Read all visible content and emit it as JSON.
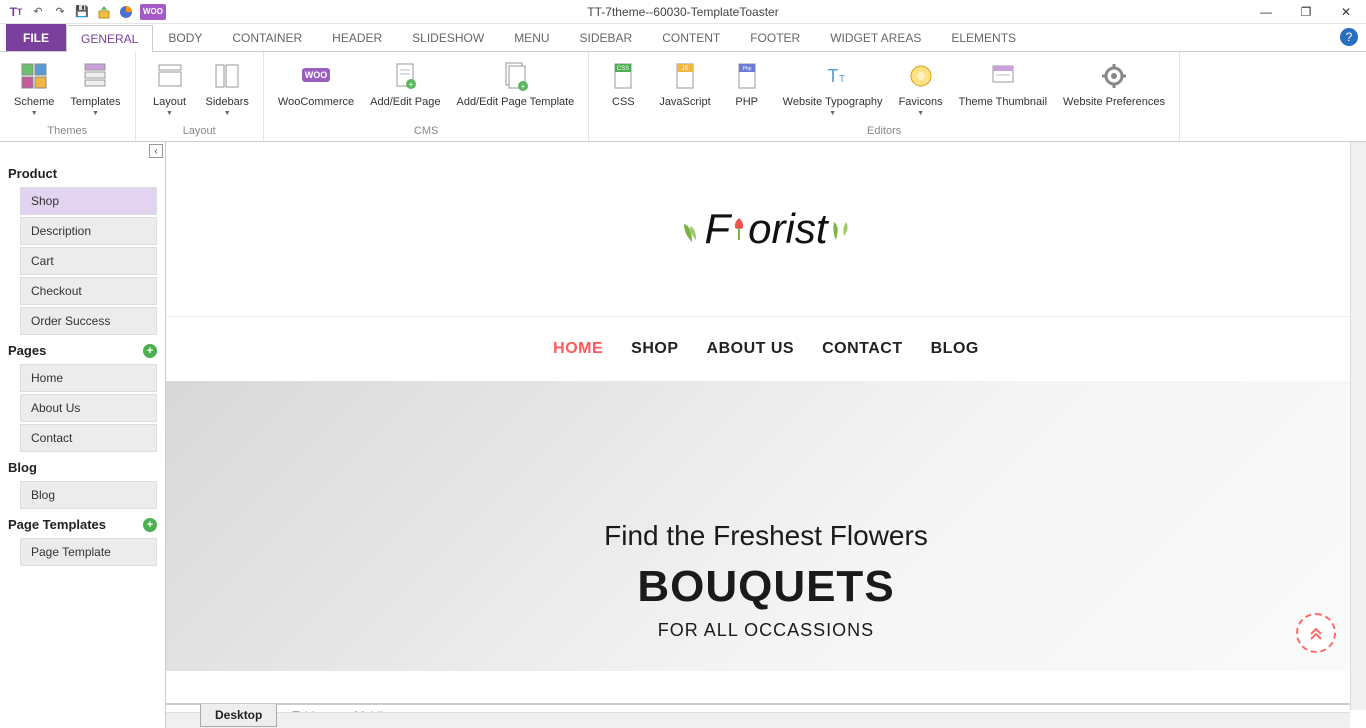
{
  "window": {
    "title": "TT-7theme--60030-TemplateToaster"
  },
  "tabs": {
    "file": "FILE",
    "items": [
      "GENERAL",
      "BODY",
      "CONTAINER",
      "HEADER",
      "SLIDESHOW",
      "MENU",
      "SIDEBAR",
      "CONTENT",
      "FOOTER",
      "WIDGET AREAS",
      "ELEMENTS"
    ],
    "active": "GENERAL"
  },
  "ribbon": {
    "groups": [
      {
        "label": "Themes",
        "buttons": [
          {
            "name": "scheme",
            "label": "Scheme",
            "dd": true
          },
          {
            "name": "templates",
            "label": "Templates",
            "dd": true
          }
        ]
      },
      {
        "label": "Layout",
        "buttons": [
          {
            "name": "layout",
            "label": "Layout",
            "dd": true
          },
          {
            "name": "sidebars",
            "label": "Sidebars",
            "dd": true
          }
        ]
      },
      {
        "label": "CMS",
        "buttons": [
          {
            "name": "woocommerce",
            "label": "WooCommerce"
          },
          {
            "name": "addedit-page",
            "label": "Add/Edit Page"
          },
          {
            "name": "addedit-pagetpl",
            "label": "Add/Edit Page Template"
          }
        ]
      },
      {
        "label": "Editors",
        "buttons": [
          {
            "name": "css",
            "label": "CSS"
          },
          {
            "name": "javascript",
            "label": "JavaScript"
          },
          {
            "name": "php",
            "label": "PHP"
          },
          {
            "name": "typography",
            "label": "Website Typography",
            "dd": true
          },
          {
            "name": "favicons",
            "label": "Favicons",
            "dd": true
          },
          {
            "name": "thumbnail",
            "label": "Theme Thumbnail"
          },
          {
            "name": "prefs",
            "label": "Website Preferences"
          }
        ]
      }
    ]
  },
  "sidepanel": {
    "sections": [
      {
        "title": "Product",
        "plus": false,
        "items": [
          "Shop",
          "Description",
          "Cart",
          "Checkout",
          "Order Success"
        ],
        "selected": "Shop"
      },
      {
        "title": "Pages",
        "plus": true,
        "items": [
          "Home",
          "About Us",
          "Contact"
        ]
      },
      {
        "title": "Blog",
        "plus": false,
        "items": [
          "Blog"
        ]
      },
      {
        "title": "Page Templates",
        "plus": true,
        "items": [
          "Page Template"
        ]
      }
    ]
  },
  "site": {
    "logo_text": "Florist",
    "nav": [
      "HOME",
      "SHOP",
      "ABOUT US",
      "CONTACT",
      "BLOG"
    ],
    "nav_active": "HOME",
    "hero": {
      "line1": "Find the Freshest Flowers",
      "line2": "BOUQUETS",
      "line3": "FOR ALL OCCASSIONS"
    }
  },
  "devtabs": {
    "items": [
      "Desktop",
      "Tablet",
      "Mobile"
    ],
    "active": "Desktop"
  }
}
